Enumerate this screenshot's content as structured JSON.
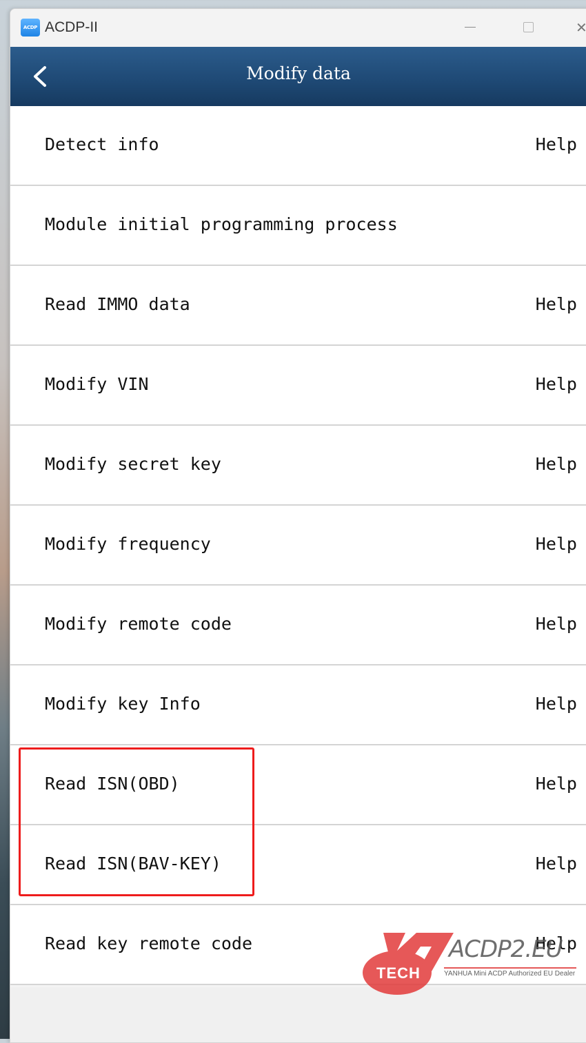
{
  "window": {
    "app_icon_text": "ACDP",
    "title": "ACDP-II",
    "close_glyph": "✕"
  },
  "header": {
    "title": "Modify data",
    "back_icon": "chevron-left-icon"
  },
  "items": [
    {
      "label": "Detect info",
      "help": "Help"
    },
    {
      "label": "Module initial programming process",
      "help": ""
    },
    {
      "label": "Read IMMO data",
      "help": "Help"
    },
    {
      "label": "Modify VIN",
      "help": "Help"
    },
    {
      "label": "Modify secret key",
      "help": "Help"
    },
    {
      "label": "Modify frequency",
      "help": "Help"
    },
    {
      "label": "Modify remote code",
      "help": "Help"
    },
    {
      "label": "Modify key Info",
      "help": "Help"
    },
    {
      "label": "Read ISN(OBD)",
      "help": "Help"
    },
    {
      "label": "Read ISN(BAV-KEY)",
      "help": "Help"
    },
    {
      "label": "Read key remote code",
      "help": "Help"
    }
  ],
  "watermark": {
    "brand": "ACDP2.EU",
    "tech": "TECH",
    "tagline": "YANHUA Mini ACDP Authorized EU Dealer"
  },
  "colors": {
    "header_bg": "#1f4a76",
    "highlight_border": "#ee1c1c",
    "row_bg": "#ffffff",
    "divider": "#d4d4d4"
  }
}
